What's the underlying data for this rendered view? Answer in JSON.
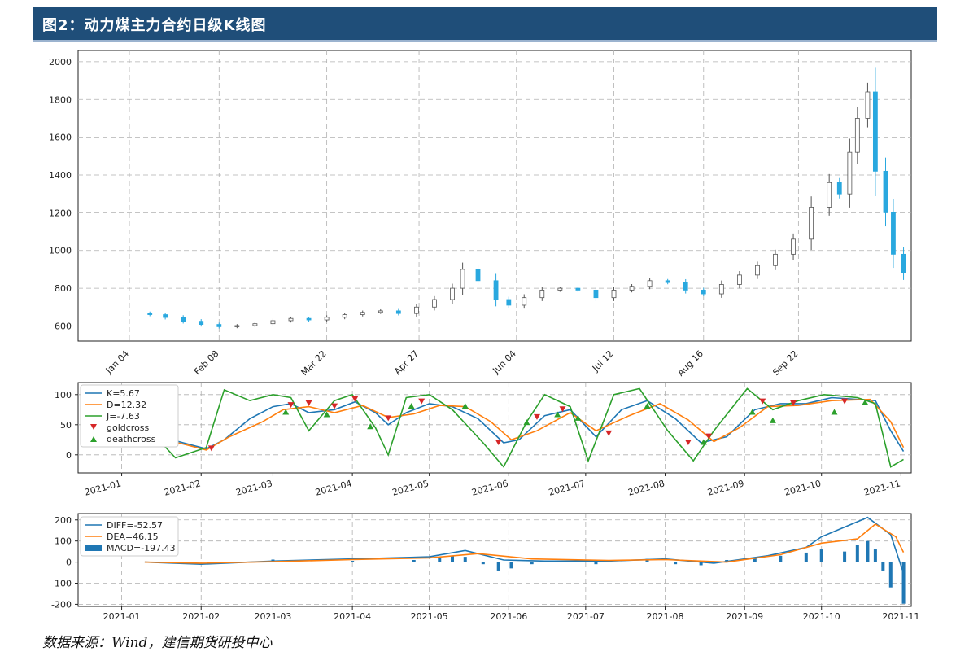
{
  "header": {
    "title": "图2：动力煤主力合约日级K线图"
  },
  "source_note": "数据来源：Wind，建信期货研投中心",
  "colors": {
    "up": "#ffffff",
    "up_stroke": "#555555",
    "down": "#29a8df",
    "K": "#1f77b4",
    "D": "#ff7f0e",
    "J": "#2ca02c",
    "gold": "#d62728",
    "death": "#2ca02c",
    "grid": "#b0b0b0",
    "header_bg": "#1f4e79"
  },
  "chart_data": [
    {
      "type": "candlestick",
      "name": "price",
      "ylim": [
        520,
        2060
      ],
      "yticks": [
        600,
        800,
        1000,
        1200,
        1400,
        1600,
        1800,
        2000
      ],
      "xticks": [
        {
          "label": "Jan 04",
          "date": "2021-01-04"
        },
        {
          "label": "Feb 08",
          "date": "2021-02-08"
        },
        {
          "label": "Mar 22",
          "date": "2021-03-22"
        },
        {
          "label": "Apr 27",
          "date": "2021-04-27"
        },
        {
          "label": "Jun 04",
          "date": "2021-06-04"
        },
        {
          "label": "Jul 12",
          "date": "2021-07-12"
        },
        {
          "label": "Aug 16",
          "date": "2021-08-16"
        },
        {
          "label": "Sep 22",
          "date": "2021-09-22"
        }
      ],
      "xrange": [
        "2020-12-15",
        "2021-11-05"
      ],
      "grid": true,
      "closes": [
        {
          "date": "2021-01-12",
          "close": 660
        },
        {
          "date": "2021-01-18",
          "close": 645
        },
        {
          "date": "2021-01-25",
          "close": 625
        },
        {
          "date": "2021-02-01",
          "close": 608
        },
        {
          "date": "2021-02-08",
          "close": 596
        },
        {
          "date": "2021-02-15",
          "close": 602
        },
        {
          "date": "2021-02-22",
          "close": 612
        },
        {
          "date": "2021-03-01",
          "close": 628
        },
        {
          "date": "2021-03-08",
          "close": 640
        },
        {
          "date": "2021-03-15",
          "close": 632
        },
        {
          "date": "2021-03-22",
          "close": 646
        },
        {
          "date": "2021-03-29",
          "close": 660
        },
        {
          "date": "2021-04-05",
          "close": 672
        },
        {
          "date": "2021-04-12",
          "close": 680
        },
        {
          "date": "2021-04-19",
          "close": 666
        },
        {
          "date": "2021-04-26",
          "close": 700
        },
        {
          "date": "2021-05-03",
          "close": 740
        },
        {
          "date": "2021-05-10",
          "close": 800
        },
        {
          "date": "2021-05-14",
          "close": 900
        },
        {
          "date": "2021-05-20",
          "close": 840
        },
        {
          "date": "2021-05-27",
          "close": 740
        },
        {
          "date": "2021-06-01",
          "close": 710
        },
        {
          "date": "2021-06-07",
          "close": 750
        },
        {
          "date": "2021-06-14",
          "close": 790
        },
        {
          "date": "2021-06-21",
          "close": 800
        },
        {
          "date": "2021-06-28",
          "close": 790
        },
        {
          "date": "2021-07-05",
          "close": 750
        },
        {
          "date": "2021-07-12",
          "close": 790
        },
        {
          "date": "2021-07-19",
          "close": 810
        },
        {
          "date": "2021-07-26",
          "close": 840
        },
        {
          "date": "2021-08-02",
          "close": 830
        },
        {
          "date": "2021-08-09",
          "close": 790
        },
        {
          "date": "2021-08-16",
          "close": 770
        },
        {
          "date": "2021-08-23",
          "close": 820
        },
        {
          "date": "2021-08-30",
          "close": 870
        },
        {
          "date": "2021-09-06",
          "close": 920
        },
        {
          "date": "2021-09-13",
          "close": 980
        },
        {
          "date": "2021-09-20",
          "close": 1060
        },
        {
          "date": "2021-09-27",
          "close": 1230
        },
        {
          "date": "2021-10-04",
          "close": 1360
        },
        {
          "date": "2021-10-08",
          "close": 1300
        },
        {
          "date": "2021-10-12",
          "close": 1520
        },
        {
          "date": "2021-10-15",
          "close": 1700
        },
        {
          "date": "2021-10-19",
          "close": 1840
        },
        {
          "date": "2021-10-22",
          "close": 1420
        },
        {
          "date": "2021-10-26",
          "close": 1200
        },
        {
          "date": "2021-10-29",
          "close": 980
        },
        {
          "date": "2021-11-02",
          "close": 880
        }
      ]
    },
    {
      "type": "line",
      "name": "kdj",
      "ylim": [
        -30,
        120
      ],
      "yticks": [
        0,
        50,
        100
      ],
      "xticks": [
        "2021-01",
        "2021-02",
        "2021-03",
        "2021-04",
        "2021-05",
        "2021-06",
        "2021-07",
        "2021-08",
        "2021-09",
        "2021-10",
        "2021-11"
      ],
      "legend_position": "upper-left",
      "legend": [
        "K=5.67",
        "D=12.32",
        "J=-7.63",
        "goldcross",
        "deathcross"
      ],
      "series": [
        {
          "name": "K=5.67",
          "points": [
            [
              "2021-01-12",
              35
            ],
            [
              "2021-01-25",
              20
            ],
            [
              "2021-02-03",
              10
            ],
            [
              "2021-02-10",
              25
            ],
            [
              "2021-02-20",
              60
            ],
            [
              "2021-03-01",
              80
            ],
            [
              "2021-03-08",
              85
            ],
            [
              "2021-03-15",
              70
            ],
            [
              "2021-03-25",
              75
            ],
            [
              "2021-04-02",
              88
            ],
            [
              "2021-04-10",
              70
            ],
            [
              "2021-04-15",
              50
            ],
            [
              "2021-04-22",
              70
            ],
            [
              "2021-05-01",
              85
            ],
            [
              "2021-05-10",
              80
            ],
            [
              "2021-05-20",
              60
            ],
            [
              "2021-05-30",
              20
            ],
            [
              "2021-06-05",
              25
            ],
            [
              "2021-06-15",
              65
            ],
            [
              "2021-06-25",
              75
            ],
            [
              "2021-07-05",
              30
            ],
            [
              "2021-07-15",
              75
            ],
            [
              "2021-07-25",
              90
            ],
            [
              "2021-08-05",
              60
            ],
            [
              "2021-08-15",
              20
            ],
            [
              "2021-08-25",
              30
            ],
            [
              "2021-09-05",
              75
            ],
            [
              "2021-09-15",
              85
            ],
            [
              "2021-09-25",
              85
            ],
            [
              "2021-10-05",
              95
            ],
            [
              "2021-10-15",
              92
            ],
            [
              "2021-10-22",
              90
            ],
            [
              "2021-10-28",
              40
            ],
            [
              "2021-11-02",
              5.67
            ]
          ]
        },
        {
          "name": "D=12.32",
          "points": [
            [
              "2021-01-12",
              30
            ],
            [
              "2021-01-25",
              18
            ],
            [
              "2021-02-03",
              8
            ],
            [
              "2021-02-12",
              30
            ],
            [
              "2021-02-25",
              55
            ],
            [
              "2021-03-05",
              75
            ],
            [
              "2021-03-15",
              80
            ],
            [
              "2021-03-25",
              70
            ],
            [
              "2021-04-05",
              82
            ],
            [
              "2021-04-15",
              62
            ],
            [
              "2021-04-25",
              68
            ],
            [
              "2021-05-05",
              82
            ],
            [
              "2021-05-15",
              80
            ],
            [
              "2021-05-25",
              55
            ],
            [
              "2021-06-02",
              25
            ],
            [
              "2021-06-12",
              40
            ],
            [
              "2021-06-25",
              70
            ],
            [
              "2021-07-05",
              40
            ],
            [
              "2021-07-18",
              65
            ],
            [
              "2021-07-30",
              85
            ],
            [
              "2021-08-10",
              58
            ],
            [
              "2021-08-20",
              22
            ],
            [
              "2021-08-30",
              45
            ],
            [
              "2021-09-10",
              80
            ],
            [
              "2021-09-22",
              82
            ],
            [
              "2021-10-05",
              90
            ],
            [
              "2021-10-20",
              92
            ],
            [
              "2021-10-28",
              55
            ],
            [
              "2021-11-02",
              12.32
            ]
          ]
        },
        {
          "name": "J=-7.63",
          "points": [
            [
              "2021-01-12",
              40
            ],
            [
              "2021-01-22",
              -5
            ],
            [
              "2021-02-03",
              12
            ],
            [
              "2021-02-10",
              108
            ],
            [
              "2021-02-20",
              90
            ],
            [
              "2021-03-01",
              100
            ],
            [
              "2021-03-08",
              95
            ],
            [
              "2021-03-15",
              40
            ],
            [
              "2021-03-25",
              90
            ],
            [
              "2021-04-01",
              100
            ],
            [
              "2021-04-10",
              45
            ],
            [
              "2021-04-15",
              0
            ],
            [
              "2021-04-22",
              95
            ],
            [
              "2021-05-01",
              100
            ],
            [
              "2021-05-10",
              75
            ],
            [
              "2021-05-22",
              20
            ],
            [
              "2021-05-30",
              -20
            ],
            [
              "2021-06-08",
              55
            ],
            [
              "2021-06-15",
              100
            ],
            [
              "2021-06-25",
              80
            ],
            [
              "2021-07-02",
              -10
            ],
            [
              "2021-07-12",
              100
            ],
            [
              "2021-07-22",
              110
            ],
            [
              "2021-08-02",
              40
            ],
            [
              "2021-08-12",
              -10
            ],
            [
              "2021-08-20",
              40
            ],
            [
              "2021-09-02",
              110
            ],
            [
              "2021-09-12",
              75
            ],
            [
              "2021-09-22",
              90
            ],
            [
              "2021-10-02",
              100
            ],
            [
              "2021-10-15",
              95
            ],
            [
              "2021-10-22",
              85
            ],
            [
              "2021-10-28",
              -20
            ],
            [
              "2021-11-02",
              -7.63
            ]
          ]
        }
      ],
      "goldcross": [
        [
          "2021-02-05",
          10
        ],
        [
          "2021-03-08",
          82
        ],
        [
          "2021-03-15",
          85
        ],
        [
          "2021-03-25",
          80
        ],
        [
          "2021-04-02",
          92
        ],
        [
          "2021-04-15",
          60
        ],
        [
          "2021-04-28",
          88
        ],
        [
          "2021-05-28",
          20
        ],
        [
          "2021-06-12",
          62
        ],
        [
          "2021-06-22",
          75
        ],
        [
          "2021-07-10",
          35
        ],
        [
          "2021-08-10",
          20
        ],
        [
          "2021-08-18",
          30
        ],
        [
          "2021-09-08",
          88
        ],
        [
          "2021-09-20",
          85
        ],
        [
          "2021-10-10",
          88
        ]
      ],
      "deathcross": [
        [
          "2021-01-20",
          25
        ],
        [
          "2021-03-06",
          72
        ],
        [
          "2021-03-22",
          68
        ],
        [
          "2021-04-08",
          48
        ],
        [
          "2021-04-24",
          82
        ],
        [
          "2021-05-15",
          82
        ],
        [
          "2021-06-08",
          55
        ],
        [
          "2021-06-20",
          68
        ],
        [
          "2021-06-28",
          62
        ],
        [
          "2021-07-25",
          82
        ],
        [
          "2021-08-16",
          22
        ],
        [
          "2021-09-04",
          72
        ],
        [
          "2021-09-12",
          58
        ],
        [
          "2021-10-06",
          72
        ],
        [
          "2021-10-18",
          88
        ]
      ]
    },
    {
      "type": "line",
      "name": "macd",
      "ylim": [
        -210,
        230
      ],
      "yticks": [
        -200,
        -100,
        0,
        100,
        200
      ],
      "xticks": [
        "2021-01",
        "2021-02",
        "2021-03",
        "2021-04",
        "2021-05",
        "2021-06",
        "2021-07",
        "2021-08",
        "2021-09",
        "2021-10",
        "2021-11"
      ],
      "legend_position": "upper-left",
      "legend": [
        "DIFF=-52.57",
        "DEA=46.15",
        "MACD=-197.43"
      ],
      "series": [
        {
          "name": "DIFF=-52.57",
          "points": [
            [
              "2021-01-10",
              0
            ],
            [
              "2021-02-01",
              -10
            ],
            [
              "2021-03-01",
              5
            ],
            [
              "2021-04-01",
              15
            ],
            [
              "2021-05-01",
              25
            ],
            [
              "2021-05-15",
              55
            ],
            [
              "2021-05-30",
              10
            ],
            [
              "2021-06-15",
              5
            ],
            [
              "2021-07-10",
              5
            ],
            [
              "2021-08-01",
              15
            ],
            [
              "2021-08-20",
              -5
            ],
            [
              "2021-09-10",
              30
            ],
            [
              "2021-09-25",
              70
            ],
            [
              "2021-10-01",
              120
            ],
            [
              "2021-10-19",
              212
            ],
            [
              "2021-10-28",
              130
            ],
            [
              "2021-11-02",
              -52.57
            ]
          ]
        },
        {
          "name": "DEA=46.15",
          "points": [
            [
              "2021-01-10",
              0
            ],
            [
              "2021-02-01",
              -5
            ],
            [
              "2021-03-01",
              2
            ],
            [
              "2021-04-01",
              12
            ],
            [
              "2021-05-01",
              20
            ],
            [
              "2021-05-20",
              40
            ],
            [
              "2021-06-10",
              15
            ],
            [
              "2021-07-10",
              8
            ],
            [
              "2021-08-01",
              12
            ],
            [
              "2021-08-25",
              0
            ],
            [
              "2021-09-15",
              35
            ],
            [
              "2021-10-01",
              90
            ],
            [
              "2021-10-15",
              110
            ],
            [
              "2021-10-22",
              180
            ],
            [
              "2021-10-30",
              120
            ],
            [
              "2021-11-02",
              46.15
            ]
          ]
        }
      ],
      "macd_bars": [
        [
          "2021-02-05",
          -8
        ],
        [
          "2021-03-01",
          12
        ],
        [
          "2021-03-10",
          8
        ],
        [
          "2021-04-01",
          6
        ],
        [
          "2021-04-25",
          10
        ],
        [
          "2021-05-05",
          20
        ],
        [
          "2021-05-10",
          30
        ],
        [
          "2021-05-15",
          25
        ],
        [
          "2021-05-22",
          -10
        ],
        [
          "2021-05-28",
          -40
        ],
        [
          "2021-06-02",
          -30
        ],
        [
          "2021-06-10",
          -10
        ],
        [
          "2021-07-05",
          -10
        ],
        [
          "2021-07-25",
          15
        ],
        [
          "2021-08-05",
          -10
        ],
        [
          "2021-08-15",
          -15
        ],
        [
          "2021-08-25",
          10
        ],
        [
          "2021-09-05",
          20
        ],
        [
          "2021-09-15",
          30
        ],
        [
          "2021-09-25",
          45
        ],
        [
          "2021-10-01",
          60
        ],
        [
          "2021-10-10",
          50
        ],
        [
          "2021-10-15",
          80
        ],
        [
          "2021-10-19",
          100
        ],
        [
          "2021-10-22",
          60
        ],
        [
          "2021-10-25",
          -40
        ],
        [
          "2021-10-28",
          -120
        ],
        [
          "2021-11-02",
          -197.43
        ]
      ]
    }
  ]
}
